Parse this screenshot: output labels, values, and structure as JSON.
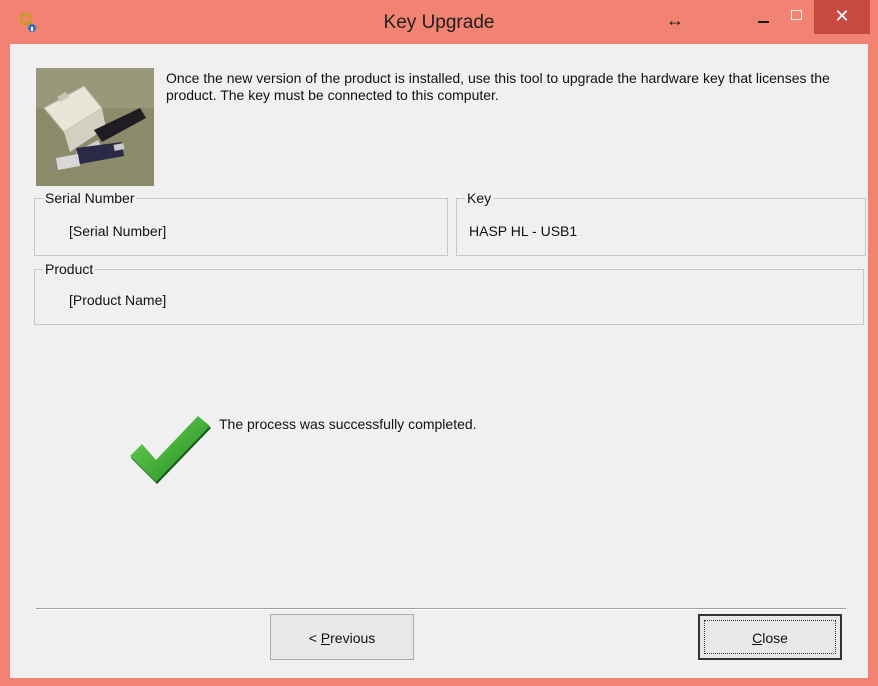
{
  "window": {
    "title": "Key Upgrade",
    "controls": {
      "resize_glyph": "↔",
      "close_glyph": "✕"
    }
  },
  "intro_text": "Once the new version of the product is installed, use this tool to upgrade the hardware key that licenses the product. The key must be connected to this computer.",
  "serial_group": {
    "label": "Serial Number",
    "value": "[Serial Number]"
  },
  "key_group": {
    "label": "Key",
    "value": "HASP HL - USB1"
  },
  "product_group": {
    "label": "Product",
    "value": "[Product Name]"
  },
  "status": {
    "icon": "green-checkmark-icon",
    "message": "The process was successfully completed."
  },
  "buttons": {
    "previous_prefix": "< ",
    "previous_accel": "P",
    "previous_rest": "revious",
    "close_accel": "C",
    "close_rest": "lose"
  },
  "colors": {
    "titlebar": "#f28372",
    "close_button": "#c74940",
    "client_bg": "#f0f0f0",
    "check_green": "#2ea52a"
  }
}
